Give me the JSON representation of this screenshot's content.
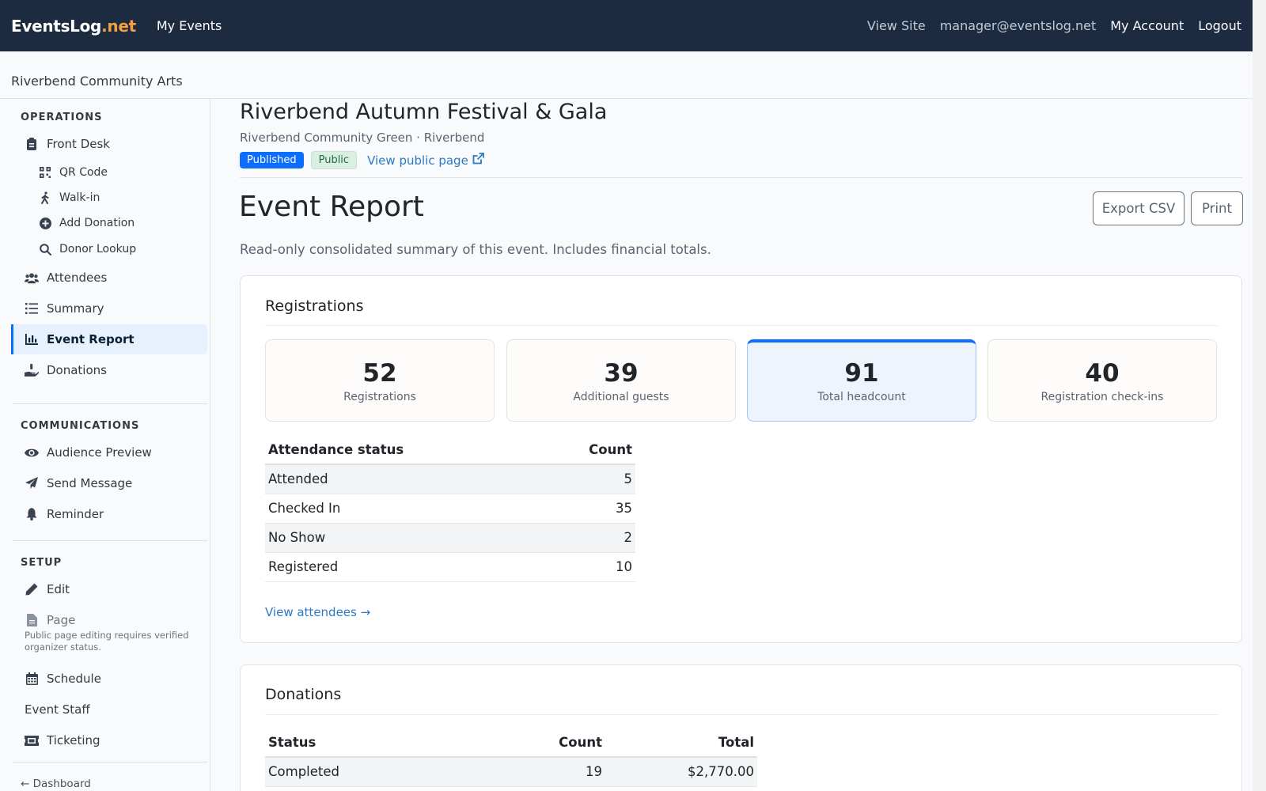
{
  "app": {
    "brand_main": "EventsLog",
    "brand_tld": ".net",
    "nav_my_events": "My Events",
    "view_site": "View Site",
    "user_email": "manager@eventslog.net",
    "my_account": "My Account",
    "logout": "Logout"
  },
  "org": {
    "name": "Riverbend Community Arts"
  },
  "sidebar": {
    "operations_title": "OPERATIONS",
    "communications_title": "COMMUNICATIONS",
    "setup_title": "SETUP",
    "front_desk": "Front Desk",
    "qr_code": "QR Code",
    "walk_in": "Walk-in",
    "add_donation": "Add Donation",
    "donor_lookup": "Donor Lookup",
    "attendees": "Attendees",
    "summary": "Summary",
    "event_report": "Event Report",
    "donations": "Donations",
    "audience_preview": "Audience Preview",
    "send_message": "Send Message",
    "reminder": "Reminder",
    "edit": "Edit",
    "page": "Page",
    "page_note": "Public page editing requires verified organizer status.",
    "schedule": "Schedule",
    "event_staff": "Event Staff",
    "ticketing": "Ticketing",
    "dashboard_link": "← Dashboard"
  },
  "event": {
    "title": "Riverbend Autumn Festival & Gala",
    "venue": "Riverbend Community Green · Riverbend",
    "badge_status": "Published",
    "badge_visibility": "Public",
    "view_public_page": "View public page"
  },
  "report": {
    "title": "Event Report",
    "description": "Read-only consolidated summary of this event. Includes financial totals.",
    "export_csv": "Export CSV",
    "print": "Print"
  },
  "registrations": {
    "heading": "Registrations",
    "stats": [
      {
        "value": "52",
        "label": "Registrations"
      },
      {
        "value": "39",
        "label": "Additional guests"
      },
      {
        "value": "91",
        "label": "Total headcount"
      },
      {
        "value": "40",
        "label": "Registration check-ins"
      }
    ],
    "table_headers": {
      "status": "Attendance status",
      "count": "Count"
    },
    "rows": [
      {
        "status": "Attended",
        "count": "5"
      },
      {
        "status": "Checked In",
        "count": "35"
      },
      {
        "status": "No Show",
        "count": "2"
      },
      {
        "status": "Registered",
        "count": "10"
      }
    ],
    "view_attendees": "View attendees →"
  },
  "donations": {
    "heading": "Donations",
    "table_headers": {
      "status": "Status",
      "count": "Count",
      "total": "Total"
    },
    "rows": [
      {
        "status": "Completed",
        "count": "19",
        "total": "$2,770.00"
      }
    ]
  },
  "colors": {
    "navbar_bg": "#1c2b3f",
    "brand_accent": "#f59f44",
    "primary": "#0d6efd",
    "link": "#2b79c2"
  }
}
